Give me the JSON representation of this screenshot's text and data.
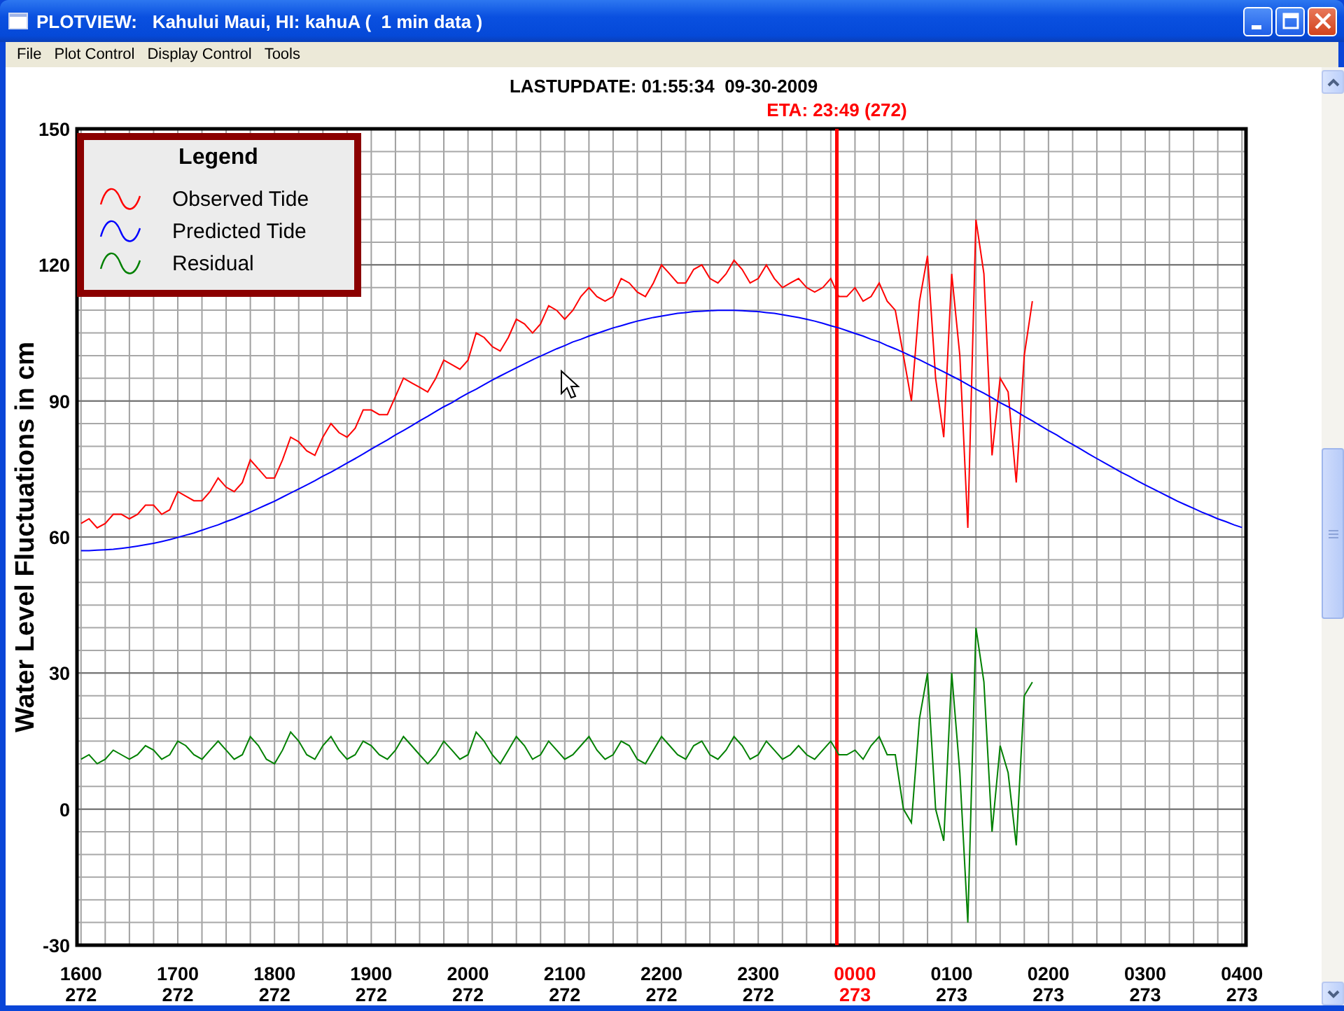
{
  "window": {
    "title": "PLOTVIEW:   Kahului Maui, HI: kahuA (  1 min data )"
  },
  "menu": [
    "File",
    "Plot Control",
    "Display Control",
    "Tools"
  ],
  "plot": {
    "chart_data": {
      "type": "line",
      "title": "LASTUPDATE: 01:55:34  09-30-2009",
      "ylabel": "Water Level Fluctuations in cm",
      "legend": {
        "title": "Legend"
      },
      "grid": true,
      "categories": [
        "1600",
        null,
        null,
        null,
        null,
        null,
        null,
        null,
        null,
        null,
        null,
        null,
        "1700",
        null,
        null,
        null,
        null,
        null,
        null,
        null,
        null,
        null,
        null,
        null,
        "1800",
        null,
        null,
        null,
        null,
        null,
        null,
        null,
        null,
        null,
        null,
        null,
        "1900",
        null,
        null,
        null,
        null,
        null,
        null,
        null,
        null,
        null,
        null,
        null,
        "2000",
        null,
        null,
        null,
        null,
        null,
        null,
        null,
        null,
        null,
        null,
        null,
        "2100",
        null,
        null,
        null,
        null,
        null,
        null,
        null,
        null,
        null,
        null,
        null,
        "2200",
        null,
        null,
        null,
        null,
        null,
        null,
        null,
        null,
        null,
        null,
        null,
        "2300",
        null,
        null,
        null,
        null,
        null,
        null,
        null,
        null,
        null,
        null,
        null,
        "0000",
        null,
        null,
        null,
        null,
        null,
        null,
        null,
        null,
        null,
        null,
        null,
        "0100",
        null,
        null,
        null,
        null,
        null,
        null,
        null,
        null,
        null,
        null,
        null,
        "0200",
        null,
        null,
        null,
        null,
        null,
        null,
        null,
        null,
        null,
        null,
        null,
        "0300",
        null,
        null,
        null,
        null,
        null,
        null,
        null,
        null,
        null,
        null,
        null,
        "0400"
      ],
      "series": [
        {
          "name": "Observed Tide",
          "color": "#ff0000",
          "values": [
            63,
            64,
            62,
            63,
            65,
            65,
            64,
            65,
            67,
            67,
            65,
            66,
            70,
            69,
            68,
            68,
            70,
            73,
            71,
            70,
            72,
            77,
            75,
            73,
            73,
            77,
            82,
            81,
            79,
            78,
            82,
            85,
            83,
            82,
            84,
            88,
            88,
            87,
            87,
            91,
            95,
            94,
            93,
            92,
            95,
            99,
            98,
            97,
            99,
            105,
            104,
            102,
            101,
            104,
            108,
            107,
            105,
            107,
            111,
            110,
            108,
            110,
            113,
            115,
            113,
            112,
            113,
            117,
            116,
            114,
            113,
            116,
            120,
            118,
            116,
            116,
            119,
            120,
            117,
            116,
            118,
            121,
            119,
            116,
            117,
            120,
            117,
            115,
            116,
            117,
            115,
            114,
            115,
            117,
            113,
            113,
            115,
            112,
            113,
            116,
            112,
            110,
            100,
            90,
            112,
            122,
            95,
            82,
            118,
            100,
            62,
            130,
            118,
            78,
            95,
            92,
            72,
            100,
            112,
            null,
            null,
            null,
            null,
            null,
            null,
            null,
            null,
            null,
            null,
            null,
            null,
            null,
            null,
            null,
            null,
            null,
            null,
            null,
            null,
            null,
            null,
            null,
            null,
            null,
            null
          ]
        },
        {
          "name": "Predicted Tide",
          "color": "#0000ff",
          "values": [
            57.0,
            57.0,
            57.1,
            57.2,
            57.3,
            57.5,
            57.7,
            58.0,
            58.3,
            58.6,
            59.0,
            59.4,
            59.9,
            60.4,
            60.9,
            61.5,
            62.1,
            62.7,
            63.4,
            64.0,
            64.8,
            65.5,
            66.3,
            67.1,
            67.9,
            68.8,
            69.7,
            70.6,
            71.5,
            72.4,
            73.4,
            74.3,
            75.3,
            76.3,
            77.3,
            78.3,
            79.4,
            80.4,
            81.4,
            82.5,
            83.5,
            84.5,
            85.6,
            86.6,
            87.7,
            88.7,
            89.6,
            90.7,
            91.7,
            92.6,
            93.6,
            94.6,
            95.5,
            96.4,
            97.3,
            98.2,
            99.1,
            99.9,
            100.7,
            101.5,
            102.2,
            103.0,
            103.6,
            104.3,
            104.9,
            105.5,
            106.1,
            106.6,
            107.1,
            107.6,
            108.0,
            108.4,
            108.7,
            109.0,
            109.3,
            109.5,
            109.7,
            109.8,
            109.9,
            110.0,
            110.0,
            110.0,
            109.9,
            109.8,
            109.7,
            109.5,
            109.3,
            109.0,
            108.7,
            108.4,
            108.0,
            107.6,
            107.1,
            106.6,
            106.1,
            105.5,
            104.9,
            104.3,
            103.6,
            103.0,
            102.2,
            101.5,
            100.7,
            99.9,
            99.1,
            98.2,
            97.3,
            96.4,
            95.5,
            94.6,
            93.6,
            92.6,
            91.7,
            90.7,
            89.6,
            88.7,
            87.7,
            86.6,
            85.6,
            84.5,
            83.5,
            82.5,
            81.4,
            80.4,
            79.4,
            78.3,
            77.3,
            76.3,
            75.3,
            74.3,
            73.4,
            72.4,
            71.5,
            70.6,
            69.7,
            68.8,
            67.9,
            67.1,
            66.3,
            65.5,
            64.8,
            64.0,
            63.4,
            62.7,
            62.1
          ]
        },
        {
          "name": "Residual",
          "color": "#008000",
          "values": [
            11,
            12,
            10,
            11,
            13,
            12,
            11,
            12,
            14,
            13,
            11,
            12,
            15,
            14,
            12,
            11,
            13,
            15,
            13,
            11,
            12,
            16,
            14,
            11,
            10,
            13,
            17,
            15,
            12,
            11,
            14,
            16,
            13,
            11,
            12,
            15,
            14,
            12,
            11,
            13,
            16,
            14,
            12,
            10,
            12,
            15,
            13,
            11,
            12,
            17,
            15,
            12,
            10,
            13,
            16,
            14,
            11,
            12,
            15,
            13,
            11,
            12,
            14,
            16,
            13,
            11,
            12,
            15,
            14,
            11,
            10,
            13,
            16,
            14,
            12,
            11,
            14,
            15,
            12,
            11,
            13,
            16,
            14,
            11,
            12,
            15,
            13,
            11,
            12,
            14,
            12,
            11,
            13,
            15,
            12,
            12,
            13,
            11,
            14,
            16,
            12,
            12,
            0,
            -3,
            20,
            30,
            0,
            -7,
            30,
            8,
            -25,
            40,
            28,
            -5,
            14,
            8,
            -8,
            25,
            28,
            null,
            null,
            null,
            null,
            null,
            null,
            null,
            null,
            null,
            null,
            null,
            null,
            null,
            null,
            null,
            null,
            null,
            null,
            null,
            null,
            null,
            null,
            null,
            null,
            null,
            null
          ]
        }
      ],
      "ylim": [
        -30,
        150
      ],
      "yticks": [
        150,
        120,
        90,
        60,
        30,
        0,
        -30
      ],
      "annotations": [
        "ETA: 23:49 (272)"
      ]
    },
    "eta_line": {
      "level": 0.65
    },
    "day_labels": [
      {
        "text": "272",
        "highlighted": false
      },
      {
        "text": "272",
        "highlighted": false
      },
      {
        "text": "272",
        "highlighted": false
      },
      {
        "text": "272",
        "highlighted": false
      },
      {
        "text": "272",
        "highlighted": false
      },
      {
        "text": "272",
        "highlighted": false
      },
      {
        "text": "272",
        "highlighted": false
      },
      {
        "text": "272",
        "highlighted": false
      },
      {
        "text": "273",
        "highlighted": true
      },
      {
        "text": "273",
        "highlighted": false
      },
      {
        "text": "273",
        "highlighted": false
      },
      {
        "text": "273",
        "highlighted": false
      },
      {
        "text": "273",
        "highlighted": false
      }
    ]
  }
}
